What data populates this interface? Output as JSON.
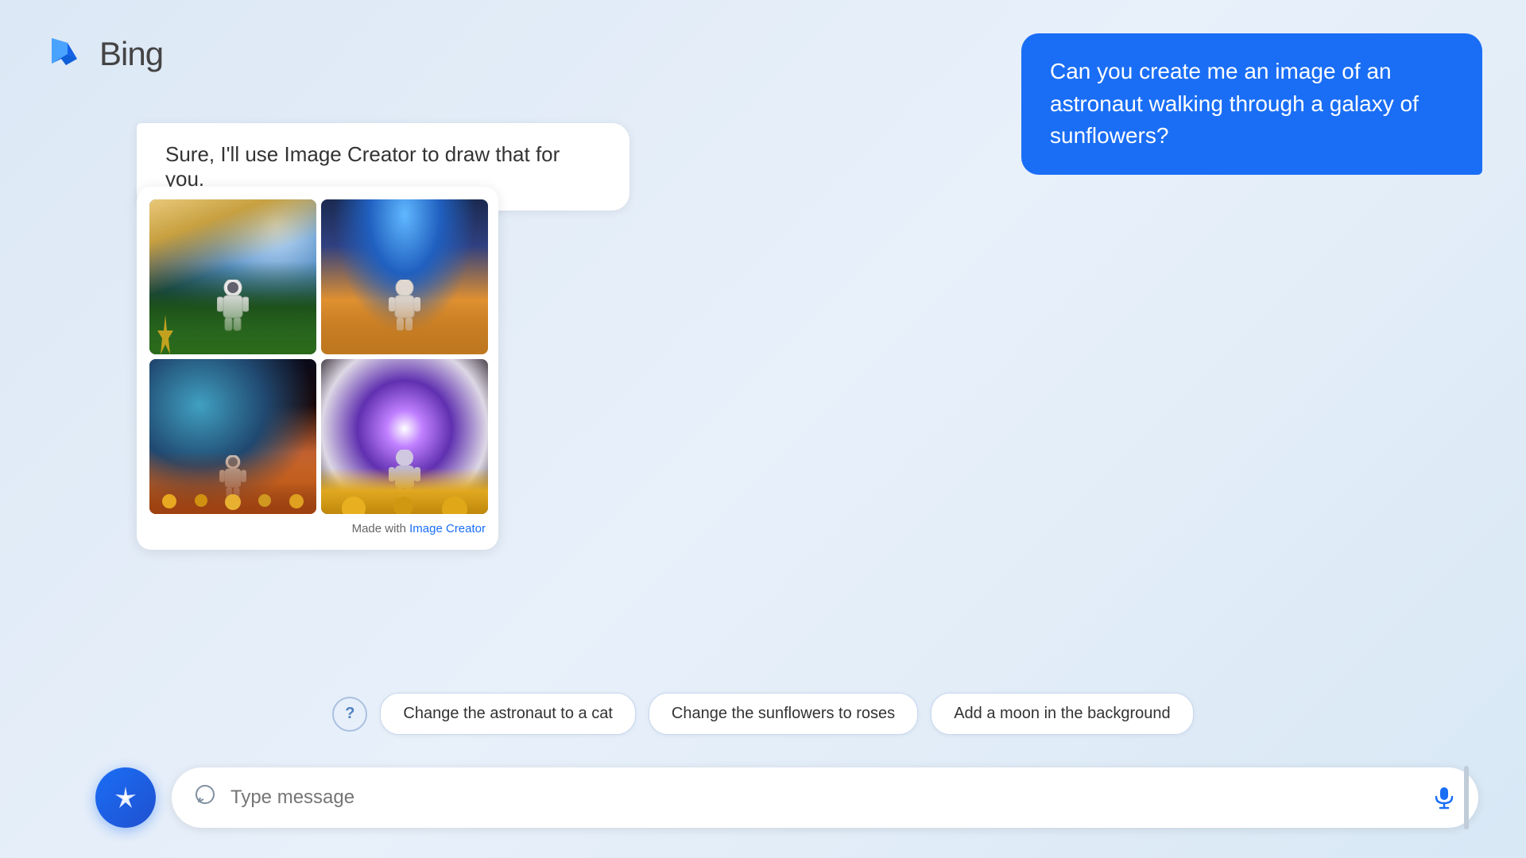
{
  "app": {
    "name": "Bing",
    "logo_text": "Bing"
  },
  "header": {
    "logo_alt": "Bing logo"
  },
  "user_message": {
    "text": "Can you create me an image of an astronaut walking through a galaxy of sunflowers?"
  },
  "bot_response": {
    "text": "Sure, I'll use Image Creator to draw that for you."
  },
  "image_grid": {
    "made_with_prefix": "Made with ",
    "made_with_link": "Image Creator"
  },
  "suggestions": {
    "help_tooltip": "?",
    "chips": [
      {
        "id": "chip-1",
        "label": "Change the astronaut to a cat"
      },
      {
        "id": "chip-2",
        "label": "Change the sunflowers to roses"
      },
      {
        "id": "chip-3",
        "label": "Add a moon in the background"
      }
    ]
  },
  "input": {
    "placeholder": "Type message"
  },
  "icons": {
    "spark": "✦",
    "chat_bubble": "💬",
    "mic": "🎤",
    "help": "?"
  }
}
